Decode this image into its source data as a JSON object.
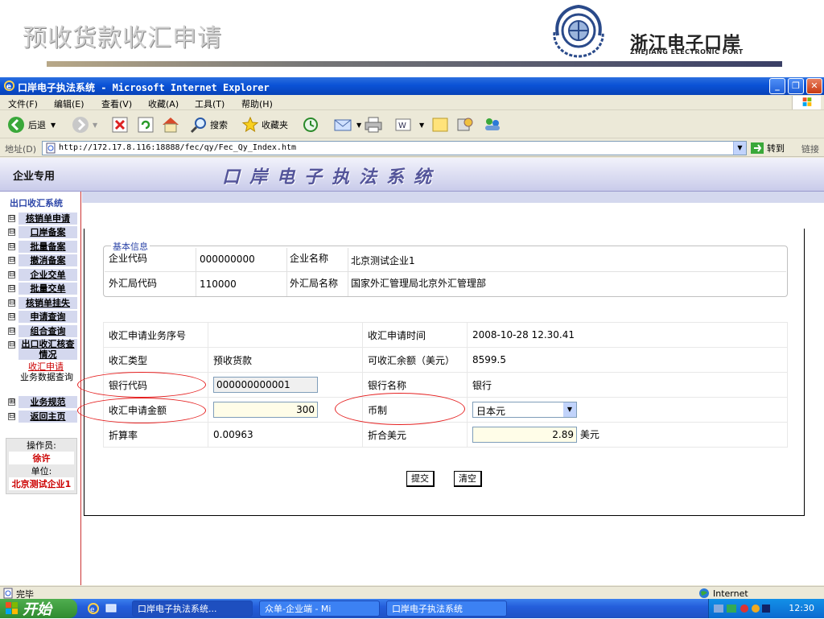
{
  "slide": {
    "title": "预收货款收汇申请",
    "port_name_cn": "浙江电子口岸",
    "port_name_en": "ZHEJIANG ELECTRONIC PORT"
  },
  "window": {
    "title": "口岸电子执法系统 - Microsoft Internet Explorer",
    "controls": [
      "_",
      "❐",
      "✕"
    ]
  },
  "menu": [
    "文件(F)",
    "编辑(E)",
    "查看(V)",
    "收藏(A)",
    "工具(T)",
    "帮助(H)"
  ],
  "toolbar": {
    "back": "后退",
    "search": "搜索",
    "favorites": "收藏夹"
  },
  "address": {
    "label": "地址(D)",
    "url": "http://172.17.8.116:18888/fec/qy/Fec_Qy_Index.htm",
    "go": "转到",
    "links": "链接"
  },
  "banner": {
    "enterprise": "企业专用",
    "system": "口岸电子执法系统"
  },
  "nav": {
    "section": "出口收汇系统",
    "items": [
      {
        "box": "⊟",
        "label": "核销单申请"
      },
      {
        "box": "⊟",
        "label": "口岸备案"
      },
      {
        "box": "⊟",
        "label": "批量备案"
      },
      {
        "box": "⊟",
        "label": "撤消备案"
      },
      {
        "box": "⊟",
        "label": "企业交单"
      },
      {
        "box": "⊟",
        "label": "批量交单"
      },
      {
        "box": "⊟",
        "label": "核销单挂失"
      },
      {
        "box": "⊟",
        "label": "申请查询"
      },
      {
        "box": "⊟",
        "label": "组合查询"
      },
      {
        "box": "⊟",
        "label": "出口收汇核查情况"
      }
    ],
    "sub_links": [
      "收汇申请",
      "业务数据查询"
    ],
    "items2": [
      {
        "box": "⊞",
        "label": "业务规范"
      },
      {
        "box": "⊟",
        "label": "返回主页"
      }
    ],
    "operator_label": "操作员:",
    "operator": "徐许",
    "unit_label": "单位:",
    "unit": "北京测试企业1"
  },
  "basic_info": {
    "legend": "基本信息",
    "rows": [
      {
        "l1": "企业代码",
        "v1": "000000000",
        "l2": "企业名称",
        "v2": "北京测试企业1"
      },
      {
        "l1": "外汇局代码",
        "v1": "110000",
        "l2": "外汇局名称",
        "v2": "国家外汇管理局北京外汇管理部"
      }
    ]
  },
  "form": {
    "seq_label": "收汇申请业务序号",
    "seq_value": "",
    "time_label": "收汇申请时间",
    "time_value": "2008-10-28 12.30.41",
    "type_label": "收汇类型",
    "type_value": "预收货款",
    "balance_label": "可收汇余额（美元）",
    "balance_value": "8599.5",
    "bank_code_label": "银行代码",
    "bank_code_value": "000000000001",
    "bank_name_label": "银行名称",
    "bank_name_value": "银行",
    "amount_label": "收汇申请金额",
    "amount_value": "300",
    "currency_label": "币制",
    "currency_value": "日本元",
    "rate_label": "折算率",
    "rate_value": "0.00963",
    "usd_label": "折合美元",
    "usd_value": "2.89",
    "usd_unit": "美元"
  },
  "buttons": {
    "submit": "提交",
    "clear": "清空"
  },
  "status": {
    "text": "完毕",
    "zone": "Internet"
  },
  "taskbar": {
    "start": "开始",
    "tasks": [
      "口岸电子执法系统...",
      "众单-企业端 - Mi",
      "口岸电子执法系统"
    ],
    "clock": "12:30"
  },
  "colors": {
    "ie_blue": "#0a52d6",
    "banner_text": "#54559a",
    "nav_bg": "#d4d8ee",
    "highlight_red": "#e52020",
    "operator_red": "#cc0000"
  }
}
